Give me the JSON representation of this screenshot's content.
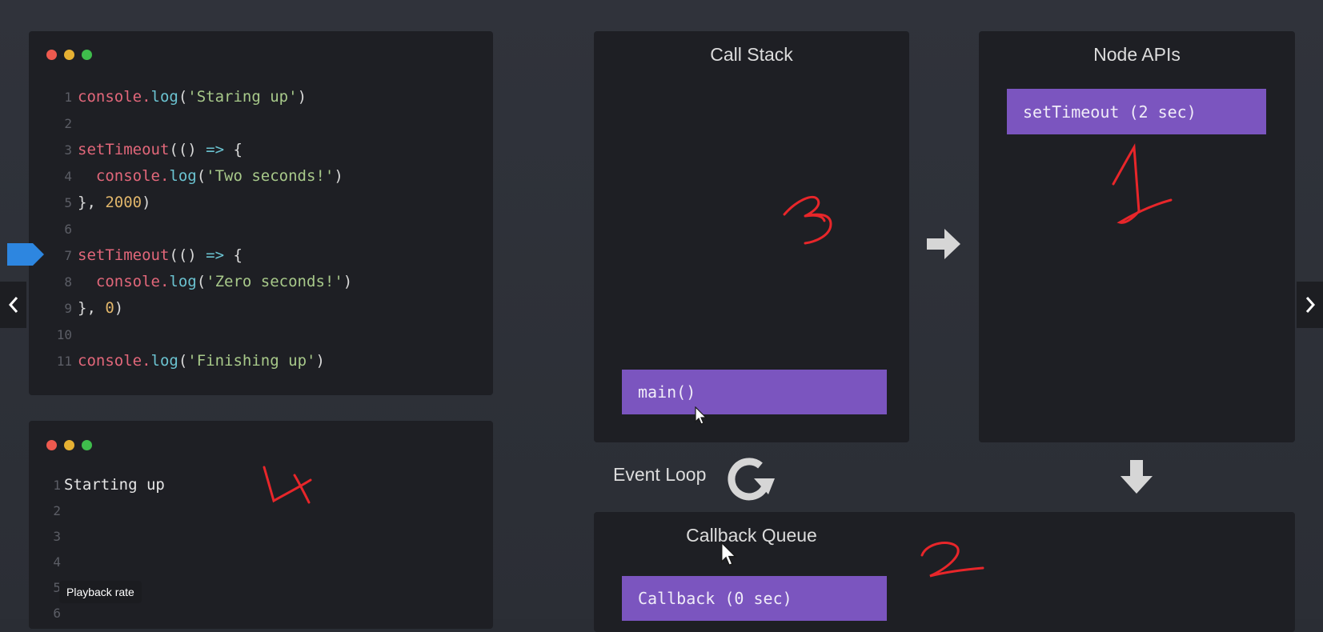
{
  "code_panel": {
    "lines": [
      {
        "n": "1",
        "parts": [
          [
            "console.",
            "kw-red"
          ],
          [
            "log",
            "kw-cyan"
          ],
          [
            "(",
            ""
          ],
          [
            "'Staring up'",
            "str"
          ],
          [
            ")",
            ""
          ]
        ]
      },
      {
        "n": "2",
        "parts": []
      },
      {
        "n": "3",
        "parts": [
          [
            "setTimeout",
            "kw-red"
          ],
          [
            "(() ",
            ""
          ],
          [
            "=>",
            "kw-cyan"
          ],
          [
            " {",
            ""
          ]
        ]
      },
      {
        "n": "4",
        "parts": [
          [
            "  console.",
            "kw-red"
          ],
          [
            "log",
            "kw-cyan"
          ],
          [
            "(",
            ""
          ],
          [
            "'Two seconds!'",
            "str"
          ],
          [
            ")",
            ""
          ]
        ]
      },
      {
        "n": "5",
        "parts": [
          [
            "}, ",
            ""
          ],
          [
            "2000",
            "num"
          ],
          [
            ")",
            ""
          ]
        ]
      },
      {
        "n": "6",
        "parts": []
      },
      {
        "n": "7",
        "parts": [
          [
            "setTimeout",
            "kw-red"
          ],
          [
            "(() ",
            ""
          ],
          [
            "=>",
            "kw-cyan"
          ],
          [
            " {",
            ""
          ]
        ]
      },
      {
        "n": "8",
        "parts": [
          [
            "  console.",
            "kw-red"
          ],
          [
            "log",
            "kw-cyan"
          ],
          [
            "(",
            ""
          ],
          [
            "'Zero seconds!'",
            "str"
          ],
          [
            ")",
            ""
          ]
        ]
      },
      {
        "n": "9",
        "parts": [
          [
            "}, ",
            ""
          ],
          [
            "0",
            "num"
          ],
          [
            ")",
            ""
          ]
        ]
      },
      {
        "n": "10",
        "parts": []
      },
      {
        "n": "11",
        "parts": [
          [
            "console.",
            "kw-red"
          ],
          [
            "log",
            "kw-cyan"
          ],
          [
            "(",
            ""
          ],
          [
            "'Finishing up'",
            "str"
          ],
          [
            ")",
            ""
          ]
        ]
      }
    ],
    "current_line": "7"
  },
  "output_panel": {
    "lines": [
      {
        "n": "1",
        "text": "Starting up"
      },
      {
        "n": "2",
        "text": ""
      },
      {
        "n": "3",
        "text": ""
      },
      {
        "n": "4",
        "text": ""
      },
      {
        "n": "5",
        "text": ""
      },
      {
        "n": "6",
        "text": ""
      }
    ]
  },
  "call_stack": {
    "title": "Call Stack",
    "items": [
      "main()"
    ]
  },
  "node_apis": {
    "title": "Node APIs",
    "items": [
      "setTimeout (2 sec)"
    ]
  },
  "event_loop": {
    "label": "Event Loop"
  },
  "callback_queue": {
    "title": "Callback Queue",
    "items": [
      "Callback (0 sec)"
    ]
  },
  "tooltip": {
    "text": "Playback rate"
  },
  "nav": {
    "prev_icon": "chevron-left-icon",
    "next_icon": "chevron-right-icon"
  },
  "annotations": [
    "1",
    "2",
    "3",
    "4"
  ],
  "colors": {
    "background": "#2b2e35",
    "panel": "#1e1f24",
    "block": "#7b55bf",
    "marker": "#2d86e0",
    "annotation": "#e8262a"
  }
}
